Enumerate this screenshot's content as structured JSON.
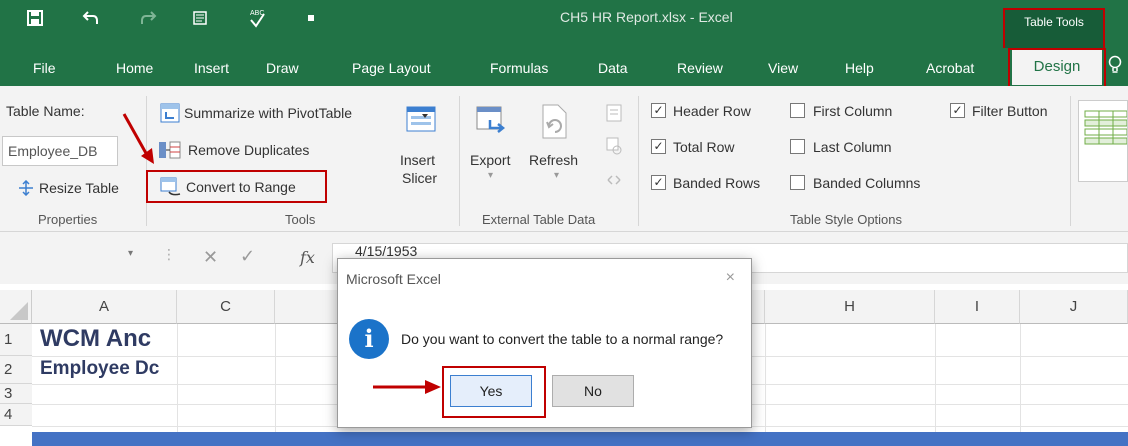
{
  "window": {
    "title": "CH5 HR Report.xlsx  -  Excel",
    "contextual_header": "Table Tools"
  },
  "quick_access": [
    "save-icon",
    "undo-icon",
    "redo-icon",
    "form-icon",
    "spelling-icon",
    "customize-icon"
  ],
  "tabs": [
    "File",
    "Home",
    "Insert",
    "Draw",
    "Page Layout",
    "Formulas",
    "Data",
    "Review",
    "View",
    "Help",
    "Acrobat",
    "Design"
  ],
  "active_tab": "Design",
  "ribbon": {
    "properties": {
      "table_name_label": "Table Name:",
      "table_name_value": "Employee_DB",
      "resize_label": "Resize Table",
      "group_label": "Properties"
    },
    "tools": {
      "summarize": "Summarize with PivotTable",
      "remove_duplicates": "Remove Duplicates",
      "convert_to_range": "Convert to Range",
      "insert_slicer_1": "Insert",
      "insert_slicer_2": "Slicer",
      "group_label": "Tools"
    },
    "external": {
      "export": "Export",
      "refresh": "Refresh",
      "group_label": "External Table Data"
    },
    "style_options": {
      "header_row": "Header Row",
      "total_row": "Total Row",
      "banded_rows": "Banded Rows",
      "first_column": "First Column",
      "last_column": "Last Column",
      "banded_columns": "Banded Columns",
      "filter_button": "Filter Button",
      "group_label": "Table Style Options",
      "checked": {
        "header_row": true,
        "total_row": true,
        "banded_rows": true,
        "first_column": false,
        "last_column": false,
        "banded_columns": false,
        "filter_button": true
      }
    }
  },
  "formula_bar": {
    "fx": "fx",
    "value": "4/15/1953"
  },
  "grid": {
    "columns": [
      "A",
      "C",
      "H",
      "I",
      "J"
    ],
    "rows": [
      "1",
      "2",
      "3",
      "4"
    ],
    "a1": "WCM Anc",
    "a2": "Employee Dc"
  },
  "dialog": {
    "title": "Microsoft Excel",
    "close": "×",
    "icon_letter": "i",
    "message": "Do you want to convert the table to a normal range?",
    "yes": "Yes",
    "no": "No"
  },
  "colors": {
    "excel_green": "#217346",
    "highlight_red": "#c00000",
    "info_blue": "#1b73c9"
  }
}
